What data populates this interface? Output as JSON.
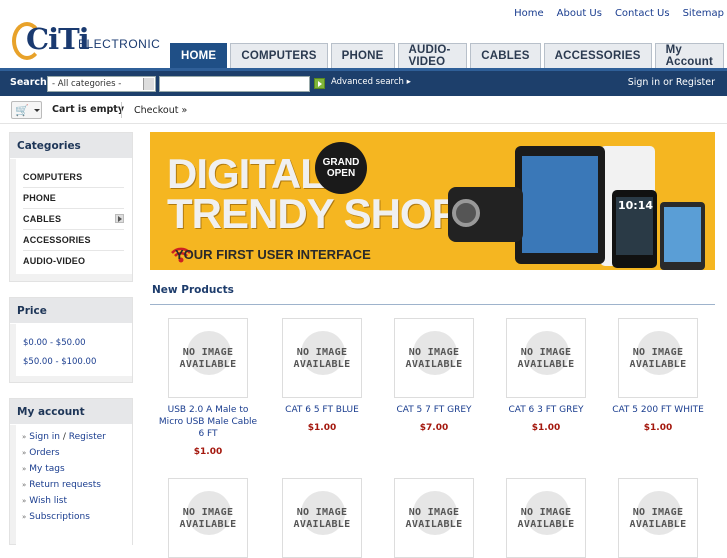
{
  "brand": {
    "name_main": "CiTi",
    "name_sub": "ELECTRONIC"
  },
  "top_links": [
    "Home",
    "About Us",
    "Contact Us",
    "Sitemap"
  ],
  "tabs": [
    {
      "label": "HOME",
      "active": true
    },
    {
      "label": "COMPUTERS",
      "active": false
    },
    {
      "label": "PHONE",
      "active": false
    },
    {
      "label": "AUDIO-VIDEO",
      "active": false
    },
    {
      "label": "CABLES",
      "active": false
    },
    {
      "label": "ACCESSORIES",
      "active": false
    },
    {
      "label": "My Account",
      "active": false
    }
  ],
  "search": {
    "label": "Search:",
    "category_value": "- All categories -",
    "query_value": "",
    "advanced": "Advanced search ▸"
  },
  "auth": {
    "sign_in": "Sign in",
    "or": "or",
    "register": "Register"
  },
  "cart": {
    "status": "Cart is empty",
    "checkout": "Checkout »"
  },
  "categories": {
    "title": "Categories",
    "items": [
      "COMPUTERS",
      "PHONE",
      "CABLES",
      "ACCESSORIES",
      "AUDIO-VIDEO"
    ]
  },
  "price": {
    "title": "Price",
    "ranges": [
      "$0.00 - $50.00",
      "$50.00 - $100.00"
    ]
  },
  "account": {
    "title": "My account",
    "sign_in": "Sign in",
    "slash": "/",
    "register": "Register",
    "links": [
      "Orders",
      "My tags",
      "Return requests",
      "Wish list",
      "Subscriptions"
    ]
  },
  "banner": {
    "line1": "DIGITAL",
    "line2": "TRENDY SHOP",
    "badge": "GRAND OPEN",
    "tagline": "YOUR FIRST USER INTERFACE",
    "clock": "10:14"
  },
  "new_products": {
    "title": "New Products",
    "placeholder": "NO IMAGE AVAILABLE",
    "items": [
      {
        "name": "USB 2.0 A Male to Micro USB Male Cable 6 FT",
        "price": "$1.00"
      },
      {
        "name": "CAT 6 5 FT BLUE",
        "price": "$1.00"
      },
      {
        "name": "CAT 5 7 FT GREY",
        "price": "$7.00"
      },
      {
        "name": "CAT 6 3 FT GREY",
        "price": "$1.00"
      },
      {
        "name": "CAT 5 200 FT WHITE",
        "price": "$1.00"
      }
    ]
  },
  "colors": {
    "nav_blue": "#1f4f86",
    "search_bar": "#1d3f6b",
    "banner_yellow": "#f5b621",
    "price_red": "#a4180e"
  }
}
